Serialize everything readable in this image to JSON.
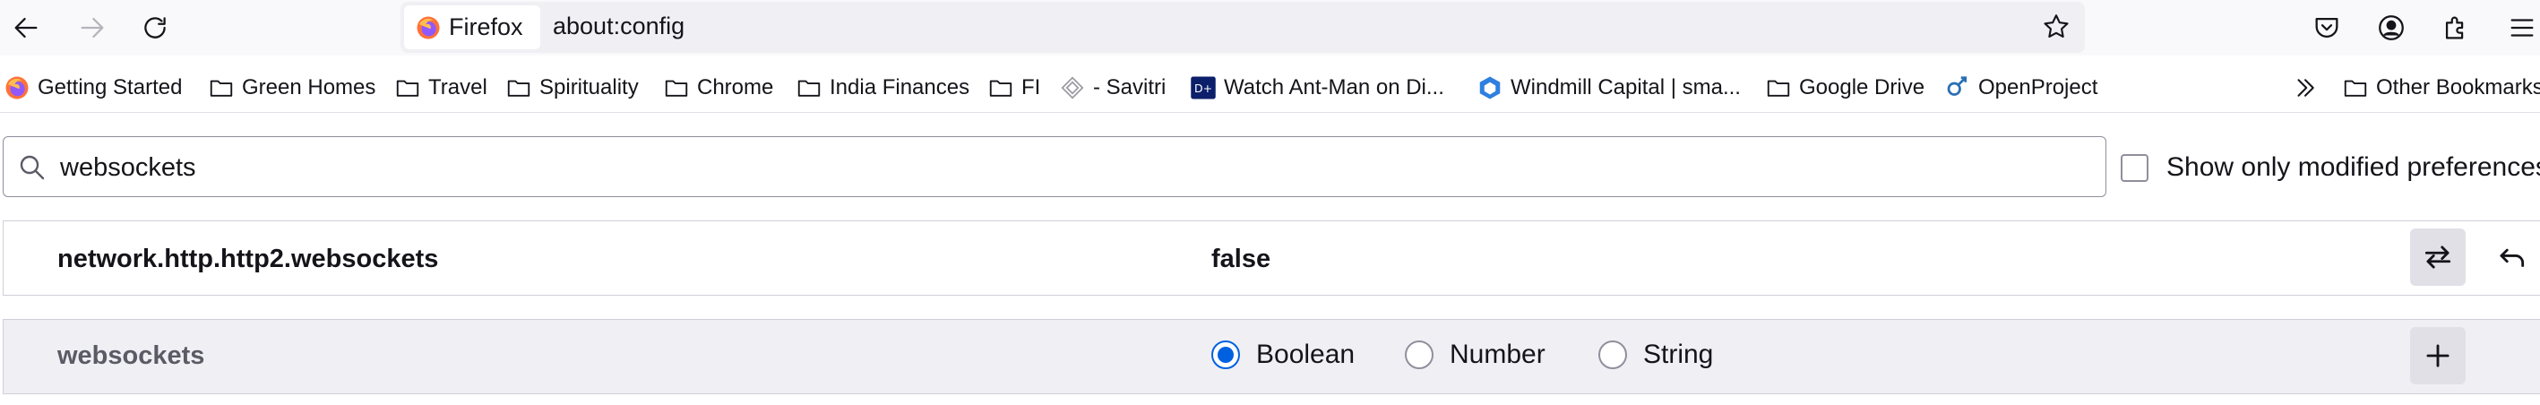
{
  "toolbar": {
    "back": "back-arrow-icon",
    "forward": "forward-arrow-icon",
    "reload": "reload-icon",
    "identity_label": "Firefox",
    "url": "about:config",
    "right_icons": [
      "pocket-icon",
      "account-icon",
      "extensions-icon",
      "menu-icon"
    ]
  },
  "bookmarks": [
    {
      "label": "Getting Started",
      "icon": "firefox-icon"
    },
    {
      "label": "Green Homes",
      "icon": "folder-icon"
    },
    {
      "label": "Travel",
      "icon": "folder-icon"
    },
    {
      "label": "Spirituality",
      "icon": "folder-icon"
    },
    {
      "label": "Chrome",
      "icon": "folder-icon"
    },
    {
      "label": "India Finances",
      "icon": "folder-icon"
    },
    {
      "label": "FI",
      "icon": "folder-icon"
    },
    {
      "label": "- Savitri",
      "icon": "site-icon"
    },
    {
      "label": "Watch Ant-Man on Di...",
      "icon": "site-icon"
    },
    {
      "label": "Windmill Capital | sma...",
      "icon": "site-icon"
    },
    {
      "label": "Google Drive",
      "icon": "folder-icon"
    },
    {
      "label": "OpenProject",
      "icon": "site-icon"
    },
    {
      "label": "Other Bookmarks",
      "icon": "folder-icon"
    }
  ],
  "config": {
    "search_value": "websockets",
    "show_modified_label": "Show only modified preferences",
    "show_modified_checked": false,
    "pref": {
      "name": "network.http.http2.websockets",
      "value": "false"
    },
    "new_pref": {
      "name": "websockets",
      "types": [
        "Boolean",
        "Number",
        "String"
      ],
      "selected": "Boolean"
    }
  },
  "colors": {
    "accent": "#0061e0",
    "toolbar_bg": "#f9f9fb",
    "urlbar_bg": "#f0f0f4"
  }
}
